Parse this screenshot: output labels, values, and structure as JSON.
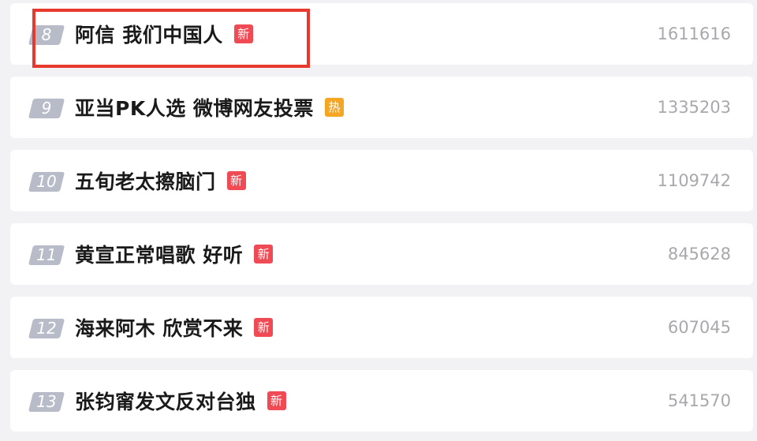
{
  "colors": {
    "page_background": "#f2f2f5",
    "rank_badge": "#b8bcc8",
    "new_badge": "#f04a55",
    "hot_badge": "#f5a623",
    "highlight_box": "#e8392f",
    "count_text": "#a8a8ad"
  },
  "items": [
    {
      "rank": "8",
      "title": "阿信 我们中国人",
      "badge": "新",
      "badge_type": "new",
      "count": "1611616"
    },
    {
      "rank": "9",
      "title": "亚当PK人选 微博网友投票",
      "badge": "热",
      "badge_type": "hot",
      "count": "1335203"
    },
    {
      "rank": "10",
      "title": "五旬老太擦脑门",
      "badge": "新",
      "badge_type": "new",
      "count": "1109742"
    },
    {
      "rank": "11",
      "title": "黄宣正常唱歌 好听",
      "badge": "新",
      "badge_type": "new",
      "count": "845628"
    },
    {
      "rank": "12",
      "title": "海来阿木 欣赏不来",
      "badge": "新",
      "badge_type": "new",
      "count": "607045"
    },
    {
      "rank": "13",
      "title": "张钧甯发文反对台独",
      "badge": "新",
      "badge_type": "new",
      "count": "541570"
    }
  ]
}
